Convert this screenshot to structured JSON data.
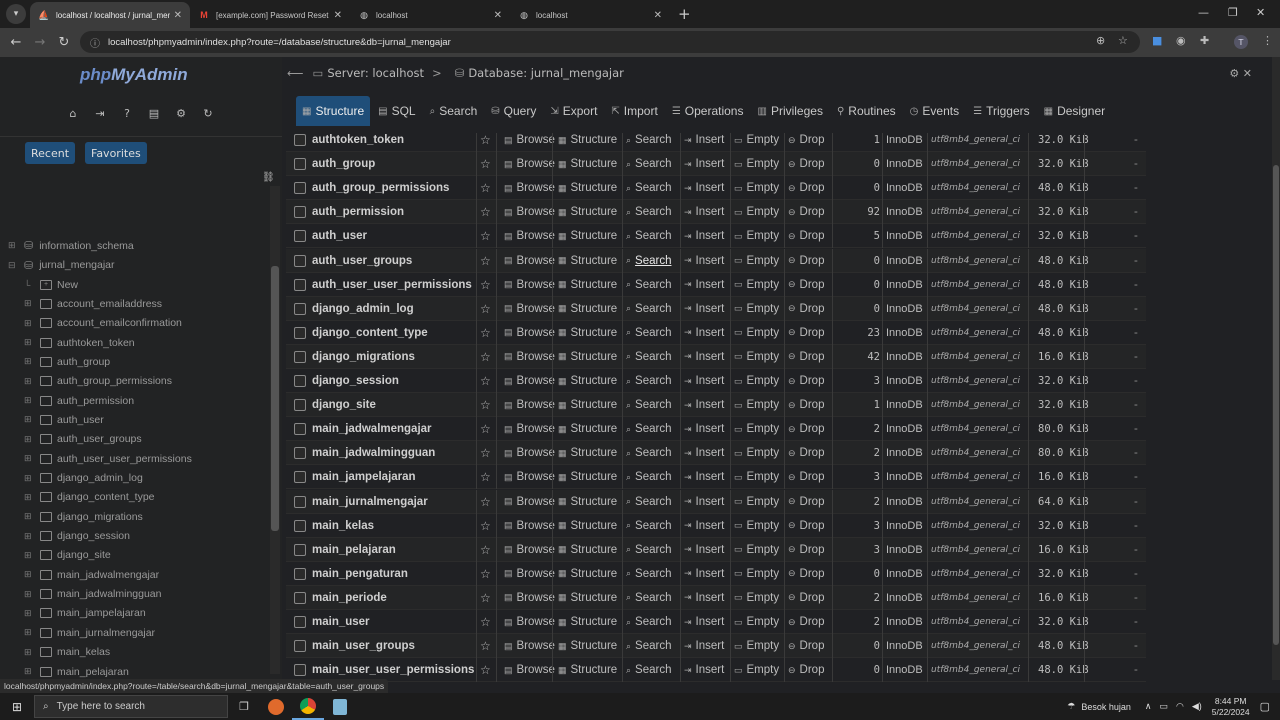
{
  "browser": {
    "tabs": [
      {
        "title": "localhost / localhost / jurnal_mengajar",
        "icon": "phpmyadmin-favicon",
        "active": true
      },
      {
        "title": "[example.com] Password Reset",
        "icon": "gmail-favicon",
        "active": false
      },
      {
        "title": "localhost",
        "icon": "globe-icon",
        "active": false
      },
      {
        "title": "localhost",
        "icon": "globe-icon",
        "active": false
      }
    ],
    "url": "localhost/phpmyadmin/index.php?route=/database/structure&db=jurnal_mengajar",
    "profile_initial": "T"
  },
  "sidebar": {
    "logo_php": "php",
    "logo_myadmin": "MyAdmin",
    "recent_label": "Recent",
    "favorites_label": "Favorites",
    "databases": [
      {
        "name": "information_schema"
      },
      {
        "name": "jurnal_mengajar"
      }
    ],
    "tables": [
      "New",
      "account_emailaddress",
      "account_emailconfirmation",
      "authtoken_token",
      "auth_group",
      "auth_group_permissions",
      "auth_permission",
      "auth_user",
      "auth_user_groups",
      "auth_user_user_permissions",
      "django_admin_log",
      "django_content_type",
      "django_migrations",
      "django_session",
      "django_site",
      "main_jadwalmengajar",
      "main_jadwalmingguan",
      "main_jampelajaran",
      "main_jurnalmengajar",
      "main_kelas",
      "main_pelajaran",
      "main_pengaturan",
      "main_periode",
      "main_user"
    ]
  },
  "breadcrumb": {
    "server": "Server: localhost",
    "separator": ">",
    "database": "Database: jurnal_mengajar"
  },
  "tabs": [
    {
      "label": "Structure",
      "icon": "structure-icon",
      "active": true
    },
    {
      "label": "SQL",
      "icon": "sql-icon"
    },
    {
      "label": "Search",
      "icon": "search-icon"
    },
    {
      "label": "Query",
      "icon": "query-icon"
    },
    {
      "label": "Export",
      "icon": "export-icon"
    },
    {
      "label": "Import",
      "icon": "import-icon"
    },
    {
      "label": "Operations",
      "icon": "operations-icon"
    },
    {
      "label": "Privileges",
      "icon": "privileges-icon"
    },
    {
      "label": "Routines",
      "icon": "routines-icon"
    },
    {
      "label": "Events",
      "icon": "events-icon"
    },
    {
      "label": "Triggers",
      "icon": "triggers-icon"
    },
    {
      "label": "Designer",
      "icon": "designer-icon"
    }
  ],
  "actions": {
    "browse": "Browse",
    "structure": "Structure",
    "search": "Search",
    "insert": "Insert",
    "empty": "Empty",
    "drop": "Drop"
  },
  "tables": [
    {
      "name": "authtoken_token",
      "rows": "1",
      "engine": "InnoDB",
      "collation": "utf8mb4_general_ci",
      "size": "32.0 KiB",
      "overhead": "-"
    },
    {
      "name": "auth_group",
      "rows": "0",
      "engine": "InnoDB",
      "collation": "utf8mb4_general_ci",
      "size": "32.0 KiB",
      "overhead": "-"
    },
    {
      "name": "auth_group_permissions",
      "rows": "0",
      "engine": "InnoDB",
      "collation": "utf8mb4_general_ci",
      "size": "48.0 KiB",
      "overhead": "-"
    },
    {
      "name": "auth_permission",
      "rows": "92",
      "engine": "InnoDB",
      "collation": "utf8mb4_general_ci",
      "size": "32.0 KiB",
      "overhead": "-"
    },
    {
      "name": "auth_user",
      "rows": "5",
      "engine": "InnoDB",
      "collation": "utf8mb4_general_ci",
      "size": "32.0 KiB",
      "overhead": "-"
    },
    {
      "name": "auth_user_groups",
      "rows": "0",
      "engine": "InnoDB",
      "collation": "utf8mb4_general_ci",
      "size": "48.0 KiB",
      "overhead": "-"
    },
    {
      "name": "auth_user_user_permissions",
      "rows": "0",
      "engine": "InnoDB",
      "collation": "utf8mb4_general_ci",
      "size": "48.0 KiB",
      "overhead": "-"
    },
    {
      "name": "django_admin_log",
      "rows": "0",
      "engine": "InnoDB",
      "collation": "utf8mb4_general_ci",
      "size": "48.0 KiB",
      "overhead": "-"
    },
    {
      "name": "django_content_type",
      "rows": "23",
      "engine": "InnoDB",
      "collation": "utf8mb4_general_ci",
      "size": "48.0 KiB",
      "overhead": "-"
    },
    {
      "name": "django_migrations",
      "rows": "42",
      "engine": "InnoDB",
      "collation": "utf8mb4_general_ci",
      "size": "16.0 KiB",
      "overhead": "-"
    },
    {
      "name": "django_session",
      "rows": "3",
      "engine": "InnoDB",
      "collation": "utf8mb4_general_ci",
      "size": "32.0 KiB",
      "overhead": "-"
    },
    {
      "name": "django_site",
      "rows": "1",
      "engine": "InnoDB",
      "collation": "utf8mb4_general_ci",
      "size": "32.0 KiB",
      "overhead": "-"
    },
    {
      "name": "main_jadwalmengajar",
      "rows": "2",
      "engine": "InnoDB",
      "collation": "utf8mb4_general_ci",
      "size": "80.0 KiB",
      "overhead": "-"
    },
    {
      "name": "main_jadwalmingguan",
      "rows": "2",
      "engine": "InnoDB",
      "collation": "utf8mb4_general_ci",
      "size": "80.0 KiB",
      "overhead": "-"
    },
    {
      "name": "main_jampelajaran",
      "rows": "3",
      "engine": "InnoDB",
      "collation": "utf8mb4_general_ci",
      "size": "16.0 KiB",
      "overhead": "-"
    },
    {
      "name": "main_jurnalmengajar",
      "rows": "2",
      "engine": "InnoDB",
      "collation": "utf8mb4_general_ci",
      "size": "64.0 KiB",
      "overhead": "-"
    },
    {
      "name": "main_kelas",
      "rows": "3",
      "engine": "InnoDB",
      "collation": "utf8mb4_general_ci",
      "size": "32.0 KiB",
      "overhead": "-"
    },
    {
      "name": "main_pelajaran",
      "rows": "3",
      "engine": "InnoDB",
      "collation": "utf8mb4_general_ci",
      "size": "16.0 KiB",
      "overhead": "-"
    },
    {
      "name": "main_pengaturan",
      "rows": "0",
      "engine": "InnoDB",
      "collation": "utf8mb4_general_ci",
      "size": "32.0 KiB",
      "overhead": "-"
    },
    {
      "name": "main_periode",
      "rows": "2",
      "engine": "InnoDB",
      "collation": "utf8mb4_general_ci",
      "size": "16.0 KiB",
      "overhead": "-"
    },
    {
      "name": "main_user",
      "rows": "2",
      "engine": "InnoDB",
      "collation": "utf8mb4_general_ci",
      "size": "32.0 KiB",
      "overhead": "-"
    },
    {
      "name": "main_user_groups",
      "rows": "0",
      "engine": "InnoDB",
      "collation": "utf8mb4_general_ci",
      "size": "48.0 KiB",
      "overhead": "-"
    },
    {
      "name": "main_user_user_permissions",
      "rows": "0",
      "engine": "InnoDB",
      "collation": "utf8mb4_general_ci",
      "size": "48.0 KiB",
      "overhead": "-"
    }
  ],
  "hovered_search_row": 5,
  "status_url": "localhost/phpmyadmin/index.php?route=/table/search&db=jurnal_mengajar&table=auth_user_groups",
  "taskbar": {
    "search_placeholder": "Type here to search",
    "weather": "Besok hujan",
    "time": "8:44 PM",
    "date": "5/22/2024"
  },
  "colors": {
    "accent": "#1f4e79",
    "background": "#202124"
  }
}
